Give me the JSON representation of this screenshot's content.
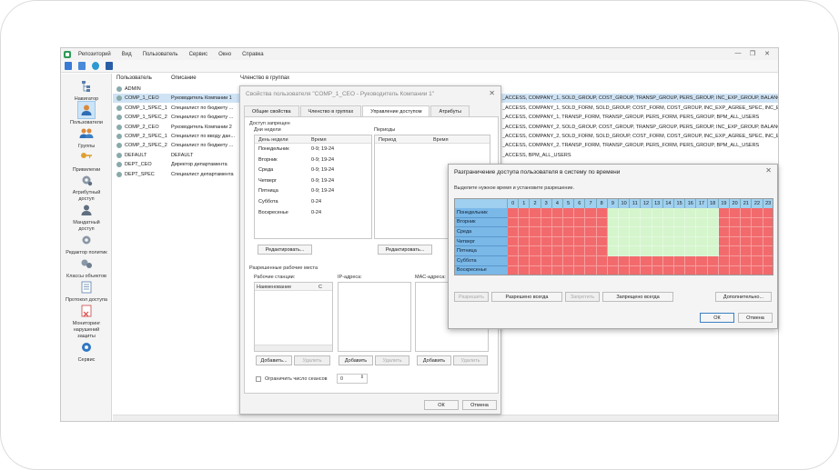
{
  "menu": [
    "Репозиторий",
    "Вид",
    "Пользователь",
    "Сервис",
    "Окно",
    "Справка"
  ],
  "nav": [
    {
      "label": "Навигатор",
      "icon": "navigator-icon"
    },
    {
      "label": "Пользователи",
      "icon": "user-icon"
    },
    {
      "label": "Группы",
      "icon": "group-icon"
    },
    {
      "label": "Привилегии",
      "icon": "key-icon"
    },
    {
      "label": "Атрибутный доступ",
      "icon": "attribute-gear-icon"
    },
    {
      "label": "Мандатный доступ",
      "icon": "mandatory-user-icon"
    },
    {
      "label": "Редактор политик",
      "icon": "policy-gear-icon"
    },
    {
      "label": "Классы объектов",
      "icon": "class-gear-icon"
    },
    {
      "label": "Протокол доступа",
      "icon": "protocol-doc-icon"
    },
    {
      "label": "Мониторинг нарушений защиты",
      "icon": "monitoring-doc-icon"
    },
    {
      "label": "Сервис",
      "icon": "service-gear-icon"
    }
  ],
  "table": {
    "headers": [
      "Пользователь",
      "Описание",
      "Членство в группах"
    ],
    "rows": [
      {
        "user": "ADMIN",
        "desc": "",
        "groups": ""
      },
      {
        "user": "COMP_1_CEO",
        "desc": "Руководитель Компании 1",
        "groups": "_ACCESS, COMPANY_1, SOLD_GROUP, COST_GROUP, TRANSP_GROUP, PERS_GROUP, INC_EXP_GROUP, BALANCE_"
      },
      {
        "user": "COMP_1_SPEC_1",
        "desc": "Специалист по бюджету ...",
        "groups": "_ACCESS, COMPANY_1, SOLD_FORM, SOLD_GROUP, COST_FORM, COST_GROUP, INC_EXP_AGREE_SPEC, INC_EXP"
      },
      {
        "user": "COMP_1_SPEC_2",
        "desc": "Специалист по бюджету ...",
        "groups": "_ACCESS, COMPANY_1, TRANSP_FORM, TRANSP_GROUP, PERS_FORM, PERS_GROUP, BPM_ALL_USERS"
      },
      {
        "user": "COMP_2_CEO",
        "desc": "Руководитель Компании 2",
        "groups": "_ACCESS, COMPANY_2, SOLD_GROUP, COST_GROUP, TRANSP_GROUP, PERS_GROUP, INC_EXP_GROUP, BALANCE_"
      },
      {
        "user": "COMP_2_SPEC_1",
        "desc": "Специалист по вводу дан...",
        "groups": "_ACCESS, COMPANY_2, SOLD_FORM, SOLD_GROUP, COST_FORM, COST_GROUP, INC_EXP_AGREE_SPEC, INC_EXP"
      },
      {
        "user": "COMP_2_SPEC_2",
        "desc": "Специалист по бюджету ...",
        "groups": "_ACCESS, COMPANY_2, TRANSP_FORM, TRANSP_GROUP, PERS_FORM, PERS_GROUP, BPM_ALL_USERS"
      },
      {
        "user": "DEFAULT",
        "desc": "DEFAULT",
        "groups": "_ACCESS, BPM_ALL_USERS"
      },
      {
        "user": "DEPT_CEO",
        "desc": "Директор департамента",
        "groups": ""
      },
      {
        "user": "DEPT_SPEC",
        "desc": "Специалист департамента",
        "groups": ""
      }
    ]
  },
  "dialog1": {
    "title": "Свойства пользователя \"COMP_1_CEO - Руководитель Компании 1\"",
    "tabs": [
      "Общие свойства",
      "Членство в группах",
      "Управление доступом",
      "Атрибуты"
    ],
    "deny_access": "Доступ запрещен",
    "days_of_week": "Дни недели",
    "col_day": "День недели",
    "col_time": "Время",
    "periods": "Периоды",
    "col_period": "Период",
    "col_ptime": "Время",
    "days": [
      {
        "day": "Понедельник",
        "time": "0-9; 19-24"
      },
      {
        "day": "Вторник",
        "time": "0-9; 19-24"
      },
      {
        "day": "Среда",
        "time": "0-9; 19-24"
      },
      {
        "day": "Четверг",
        "time": "0-9; 19-24"
      },
      {
        "day": "Пятница",
        "time": "0-9; 19-24"
      },
      {
        "day": "Суббота",
        "time": "0-24"
      },
      {
        "day": "Воскресенье",
        "time": "0-24"
      }
    ],
    "edit_btn": "Редактировать...",
    "allowed_places": "Разрешенные рабочие места",
    "workstations": "Рабочие станции:",
    "ip": "IP-адреса:",
    "mac": "MAC-адреса:",
    "col_name": "Наименование",
    "col_c": "С",
    "add_btn": "Добавить...",
    "add_btn2": "Добавить",
    "del_btn": "Удалить",
    "limit_sessions": "Ограничить число сеансов",
    "sessions_value": "0",
    "ok": "ОК",
    "cancel": "Отмена"
  },
  "dialog2": {
    "title": "Разграничение доступа пользователя в систему по времени",
    "instruction": "Выделите нужное время и установите разрешение.",
    "hours": [
      "0",
      "1",
      "2",
      "3",
      "4",
      "5",
      "6",
      "7",
      "8",
      "9",
      "10",
      "11",
      "12",
      "13",
      "14",
      "15",
      "16",
      "17",
      "18",
      "19",
      "20",
      "21",
      "22",
      "23"
    ],
    "days": [
      "Понедельник",
      "Вторник",
      "Среда",
      "Четверг",
      "Пятница",
      "Суббота",
      "Воскресенье"
    ],
    "allow_ranges": [
      [
        9,
        19
      ],
      [
        9,
        19
      ],
      [
        9,
        19
      ],
      [
        9,
        19
      ],
      [
        9,
        19
      ],
      [],
      []
    ],
    "colors": {
      "deny": "#f26a6c",
      "allow": "#d5f5cd",
      "header": "#9fd0ef",
      "day": "#7ab8e8"
    },
    "btn_allow": "Разрешить",
    "btn_allow_always": "Разрешено всегда",
    "btn_deny": "Запретить",
    "btn_deny_always": "Запрещено всегда",
    "btn_more": "Дополнительно...",
    "ok": "ОК",
    "cancel": "Отмена"
  }
}
